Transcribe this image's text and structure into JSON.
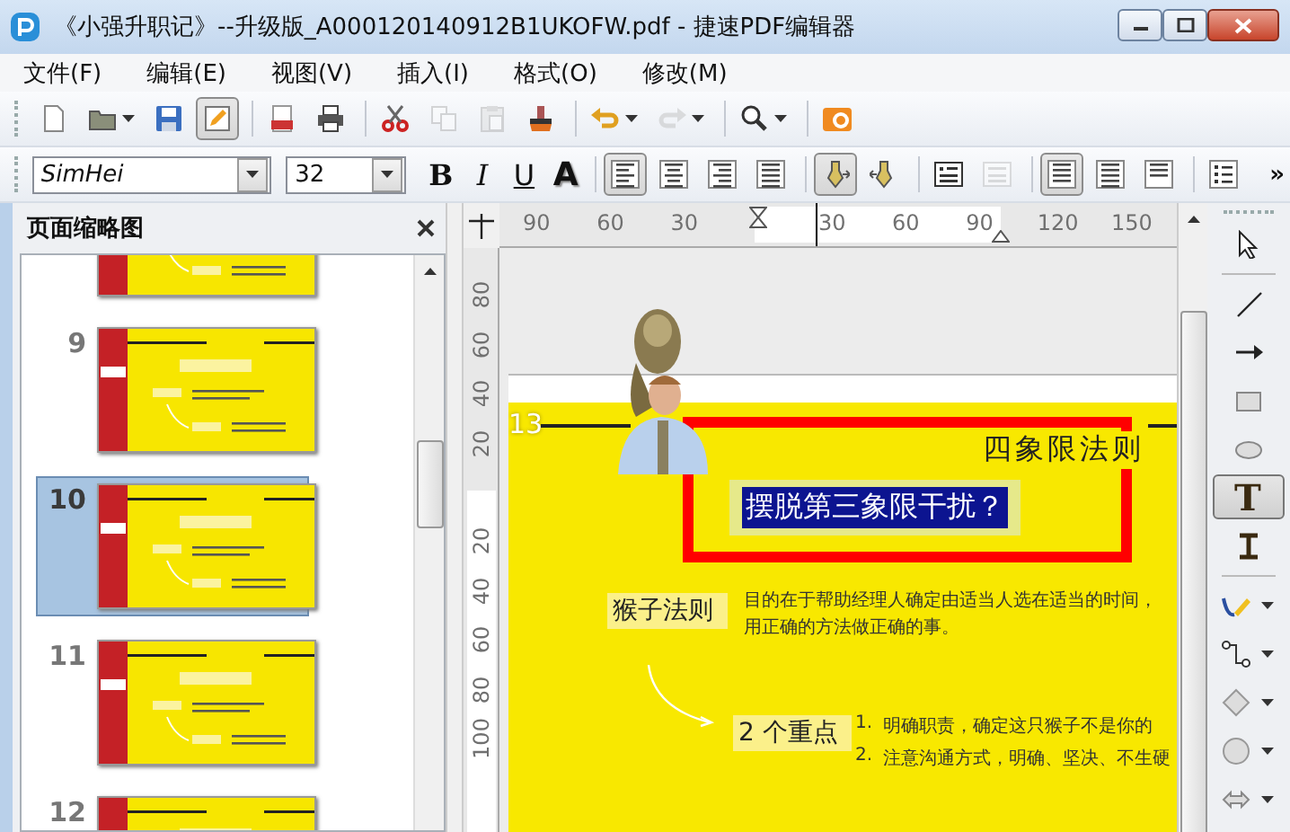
{
  "window": {
    "title": "《小强升职记》--升级版_A000120140912B1UKOFW.pdf - 捷速PDF编辑器"
  },
  "menu": [
    "文件(F)",
    "编辑(E)",
    "视图(V)",
    "插入(I)",
    "格式(O)",
    "修改(M)"
  ],
  "toolbar": [
    {
      "selected": false,
      "disabled": false
    },
    {
      "selected": false,
      "disabled": false,
      "dropdown": true
    },
    {
      "selected": false,
      "disabled": false
    },
    {
      "selected": true,
      "disabled": false
    },
    {
      "selected": false,
      "disabled": false
    },
    {
      "selected": false,
      "disabled": false
    },
    {
      "selected": false,
      "disabled": false
    },
    {
      "selected": false,
      "disabled": true
    },
    {
      "selected": false,
      "disabled": true
    },
    {
      "selected": false,
      "disabled": false
    },
    {
      "selected": false,
      "disabled": false,
      "dropdown": true
    },
    {
      "selected": false,
      "disabled": true,
      "dropdown": true
    },
    {
      "selected": false,
      "disabled": false,
      "dropdown": true
    },
    {
      "selected": false,
      "disabled": false
    }
  ],
  "format_bar": {
    "font": "SimHei",
    "size": "32",
    "styles": [
      "B",
      "I",
      "U",
      "A"
    ],
    "buttons": [
      {
        "selected": true,
        "disabled": false
      },
      {
        "selected": false,
        "disabled": false
      },
      {
        "selected": false,
        "disabled": false
      },
      {
        "selected": false,
        "disabled": false
      },
      {
        "selected": true,
        "disabled": false
      },
      {
        "selected": false,
        "disabled": false
      },
      {
        "selected": false,
        "disabled": false
      },
      {
        "selected": false,
        "disabled": true
      },
      {
        "selected": true,
        "disabled": false
      },
      {
        "selected": false,
        "disabled": false
      },
      {
        "selected": false,
        "disabled": false
      },
      {
        "selected": false,
        "disabled": false
      }
    ],
    "more": "»"
  },
  "thumbnail_panel": {
    "title": "页面缩略图",
    "pages": [
      {
        "selected": false
      },
      {
        "number": "9",
        "selected": false
      },
      {
        "number": "10",
        "selected": true
      },
      {
        "number": "11",
        "selected": false
      },
      {
        "number": "12",
        "selected": false
      }
    ]
  },
  "ruler_top": {
    "before": [
      "90",
      "60",
      "30"
    ],
    "after": [
      "30",
      "60",
      "90",
      "120",
      "150"
    ]
  },
  "ruler_left": {
    "before": [
      "80",
      "60",
      "40",
      "20"
    ],
    "after": [
      "20",
      "40",
      "60",
      "80",
      "100"
    ]
  },
  "slide": {
    "number": "13",
    "heading": "四象限法则",
    "question": "摆脱第三象限干扰？",
    "question_selected": true,
    "rows": [
      {
        "tag": "猴子法则",
        "text": "目的在于帮助经理人确定由适当人选在适当的时间，用正确的方法做正确的事。"
      },
      {
        "tag": "2 个重点",
        "items": [
          {
            "marker": "1.",
            "text": "明确职责，确定这只猴子不是你的"
          },
          {
            "marker": "2.",
            "text": "注意沟通方式，明确、坚决、不生硬"
          }
        ]
      }
    ]
  },
  "tools": [
    {
      "selected": false
    },
    {
      "selected": false
    },
    {
      "selected": false
    },
    {
      "selected": false
    },
    {
      "selected": false
    },
    {
      "selected": true,
      "label": "T"
    },
    {
      "selected": false
    },
    {
      "selected": false,
      "dropdown": true
    },
    {
      "selected": false,
      "dropdown": true
    },
    {
      "selected": false,
      "dropdown": true
    },
    {
      "selected": false,
      "dropdown": true
    },
    {
      "selected": false,
      "dropdown": true
    }
  ]
}
